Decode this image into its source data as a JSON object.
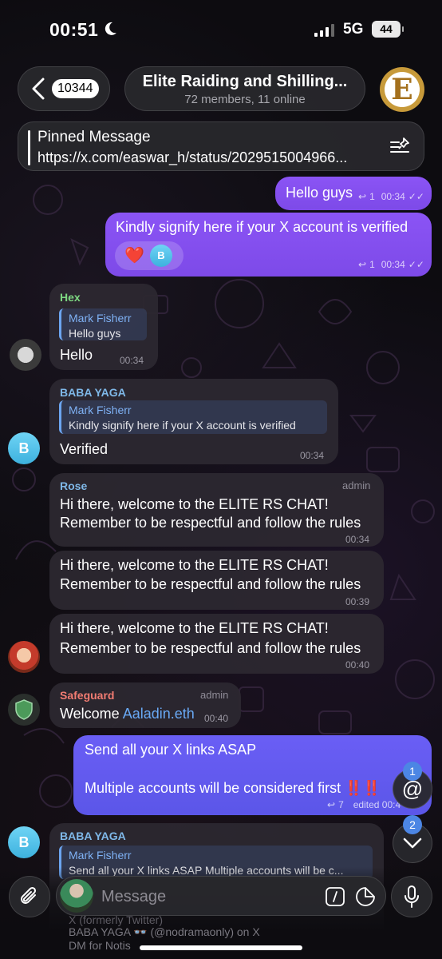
{
  "status": {
    "time": "00:51",
    "network": "5G",
    "battery": "44"
  },
  "header": {
    "back_count": "10344",
    "title": "Elite Raiding and Shilling...",
    "subtitle": "72 members, 11 online",
    "avatar_letter": "E"
  },
  "pinned": {
    "title": "Pinned Message",
    "text": "https://x.com/easwar_h/status/2029515004966..."
  },
  "messages": {
    "out1": {
      "text": "Hello guys",
      "replies": "1",
      "time": "00:34"
    },
    "out2": {
      "text": "Kindly signify here if your X account is verified",
      "replies": "1",
      "time": "00:34",
      "reaction_emoji": "❤️",
      "reaction_letter": "B"
    },
    "hex": {
      "sender": "Hex",
      "quote_name": "Mark Fisherr",
      "quote_text": "Hello guys",
      "text": "Hello",
      "time": "00:34"
    },
    "baba1": {
      "sender": "BABA YAGA",
      "avatar_letter": "B",
      "quote_name": "Mark Fisherr",
      "quote_text": "Kindly signify here if your X account is verified",
      "text": "Verified",
      "time": "00:34"
    },
    "rose1": {
      "sender": "Rose",
      "badge": "admin",
      "line1": "Hi there, welcome to the ELITE RS CHAT!",
      "line2": "Remember to be respectful and follow the rules",
      "time": "00:34"
    },
    "rose2": {
      "line1": "Hi there, welcome to the ELITE RS CHAT!",
      "line2": "Remember to be respectful and follow the rules",
      "time": "00:39"
    },
    "rose3": {
      "line1": "Hi there, welcome to the ELITE RS CHAT!",
      "line2": "Remember to be respectful and follow the rules",
      "time": "00:40"
    },
    "safeguard": {
      "sender": "Safeguard",
      "badge": "admin",
      "text": "Welcome ",
      "link": "Aaladin.eth",
      "time": "00:40"
    },
    "out3": {
      "line1": "Send all your X links ASAP",
      "line2": "Multiple accounts will be considered first ‼️‼️",
      "replies": "7",
      "edited": "edited 00:4"
    },
    "baba2": {
      "sender": "BABA YAGA",
      "avatar_letter": "B",
      "quote_name": "Mark Fisherr",
      "quote_text": "Send all your X links ASAP Multiple accounts will be c..."
    }
  },
  "fabs": {
    "mention_count": "1",
    "down_count": "2"
  },
  "composer": {
    "placeholder": "Message"
  },
  "link_preview": {
    "line1": "X (formerly Twitter)",
    "line2": "BABA YAGA 👓 (@nodramaonly) on X",
    "line3": "DM for Notis"
  },
  "colors": {
    "out_bubble": "#8b54f5",
    "out_bubble_blue": "#5b56e8",
    "in_bubble": "#2c2830",
    "link": "#69a9f5",
    "sender_hex": "#7ed882",
    "sender_baba": "#7fb8e8",
    "sender_rose": "#7fb8e8",
    "sender_safeguard": "#f27c72"
  }
}
